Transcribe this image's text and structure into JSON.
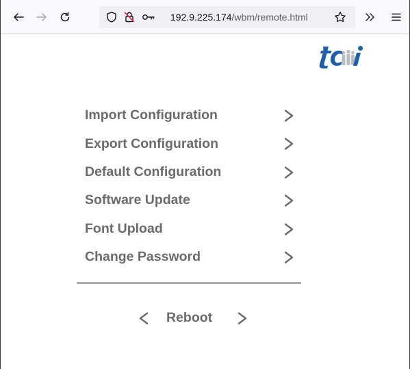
{
  "browser": {
    "url_host": "192.9.225.174",
    "url_path": "/wbm/remote.html",
    "icons": {
      "back": "back-arrow-icon",
      "forward": "forward-arrow-icon",
      "reload": "reload-icon",
      "shield": "tracking-protection-shield-icon",
      "insecure": "insecure-connection-icon",
      "key": "key-icon",
      "bookmark": "bookmark-star-icon",
      "overflow": "overflow-chevrons-icon",
      "menu": "hamburger-menu-icon"
    }
  },
  "logo": {
    "text": "tci",
    "color": "#1f5ea8"
  },
  "menu": {
    "items": [
      {
        "label": "Import Configuration"
      },
      {
        "label": "Export Configuration"
      },
      {
        "label": "Default Configuration"
      },
      {
        "label": "Software Update"
      },
      {
        "label": "Font Upload"
      },
      {
        "label": "Change Password"
      }
    ],
    "text_color": "#6b6b6b"
  },
  "reboot": {
    "label": "Reboot"
  }
}
